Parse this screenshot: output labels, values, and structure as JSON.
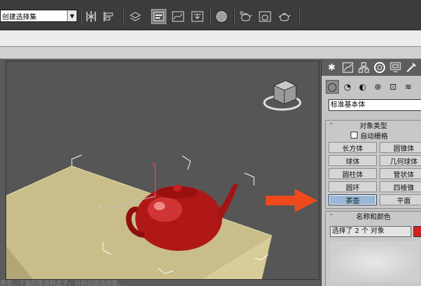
{
  "toolbar": {
    "selection_set_value": "创建选择集",
    "icons": [
      "mirror-icon",
      "align-icon",
      "layer-manager-icon",
      "scene-explorer-icon",
      "curve-editor-icon",
      "schematic-view-icon",
      "material-editor-icon",
      "render-setup-icon",
      "rendered-frame-icon",
      "render-icon"
    ]
  },
  "viewport": {
    "axis_labels": {
      "x": "x",
      "y": "y",
      "z": "z"
    },
    "colors": {
      "teapot": "#b01818",
      "box": "#c9bd8a",
      "background": "#565656"
    }
  },
  "command_panel": {
    "tabs": [
      "create-tab",
      "modify-tab",
      "hierarchy-tab",
      "motion-tab",
      "display-tab",
      "utilities-tab"
    ],
    "subtabs": [
      "geometry",
      "shapes",
      "lights",
      "cameras",
      "helpers",
      "space-warps",
      "systems"
    ],
    "category_dropdown": "标准基本体",
    "object_type_rollout": {
      "title": "对象类型",
      "autogrid_label": "自动栅格",
      "buttons": [
        "长方体",
        "圆锥体",
        "球体",
        "几何球体",
        "圆柱体",
        "管状体",
        "圆环",
        "四棱锥",
        "茶壶",
        "平面"
      ],
      "selected": "茶壶"
    },
    "name_color_rollout": {
      "title": "名称和颜色",
      "name_value": "选择了 2 个 对象",
      "color": "#d02020"
    }
  },
  "annotation": {
    "arrow_color": "#ee4a1c"
  },
  "bottom_caption": "茶壶，下面的茶壶和盒子，分别创建选择集..."
}
